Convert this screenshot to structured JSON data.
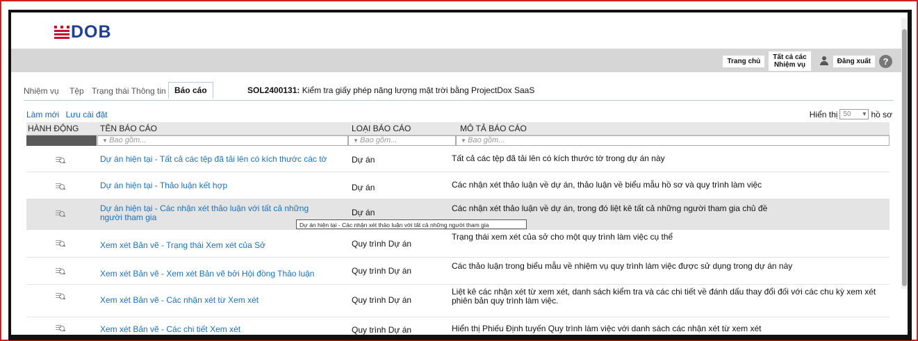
{
  "logo": {
    "text": "DOB"
  },
  "top_links": {
    "home": "Trang chủ",
    "all_tasks_line1": "Tất cả các",
    "all_tasks_line2": "Nhiệm vụ",
    "logout": "Đăng xuất",
    "help": "?"
  },
  "tabs": [
    {
      "label": "Nhiệm vụ"
    },
    {
      "label": "Tệp"
    },
    {
      "label": "Trạng thái Thông tin"
    },
    {
      "label": "Báo cáo",
      "active": true
    }
  ],
  "project": {
    "id": "SOL2400131:",
    "title": " Kiểm tra giấy phép năng lượng mặt trời bằng ProjectDox SaaS"
  },
  "toolbar": {
    "refresh": "Làm mới",
    "save_settings": "Lưu cài đặt"
  },
  "paging": {
    "show_label": "Hiển thị",
    "page_size": "50",
    "records_label": "hồ sơ"
  },
  "columns": {
    "action": "HÀNH ĐỘNG",
    "name": "TÊN BÁO CÁO",
    "type": "LOẠI BÁO CÁO",
    "desc": "MÔ TẢ BÁO CÁO"
  },
  "filters": {
    "name": "Bao gồm...",
    "type": "Bao gồm...",
    "desc": "Bao gồm..."
  },
  "rows": [
    {
      "name": "Dự án hiện tại - Tất cả các tệp đã tải lên có kích thước các tờ",
      "type": "Dự án",
      "desc": "Tất cả các tệp đã tải lên có kích thước tờ trong dự án này"
    },
    {
      "name": "Dự án hiện tại - Thảo luận kết hợp",
      "type": "Dự án",
      "desc": "Các nhận xét thảo luận về dự án, thảo luận về biểu mẫu hồ sơ và quy trình làm việc"
    },
    {
      "name": "Dự án hiện tại - Các nhận xét thảo luận với tất cả những người tham gia",
      "type": "Dự án",
      "desc": "Các nhận xét thảo luận về dự án, trong đó liệt kê tất cả những người tham gia chủ đề"
    },
    {
      "name": "Xem xét Bản vẽ - Trạng thái Xem xét của Sở",
      "type": "Quy trình Dự án",
      "desc": "Trạng thái xem xét của sở cho một quy trình làm việc cụ thể"
    },
    {
      "name": "Xem xét Bản vẽ - Xem xét Bản vẽ bởi Hội đồng Thảo luận",
      "type": "Quy trình Dự án",
      "desc": "Các thảo luận trong biểu mẫu về nhiệm vụ quy trình làm việc được sử dụng trong dự án này"
    },
    {
      "name": "Xem xét Bản vẽ - Các nhận xét từ Xem xét",
      "type": "Quy trình Dự án",
      "desc": "Liệt kê các nhận xét từ xem xét, danh sách kiểm tra và các chi tiết về đánh dấu thay đổi đối với các chu kỳ xem xét phiên bản quy trình làm việc."
    },
    {
      "name": "Xem xét Bản vẽ - Các chi tiết Xem xét",
      "type": "Quy trình Dự án",
      "desc": "Hiển thị Phiếu Định tuyến Quy trình làm việc với danh sách các nhận xét từ xem xét"
    }
  ],
  "tooltip": "Dự án hiện tại - Các nhận xét thảo luận với tất cả những người tham gia"
}
